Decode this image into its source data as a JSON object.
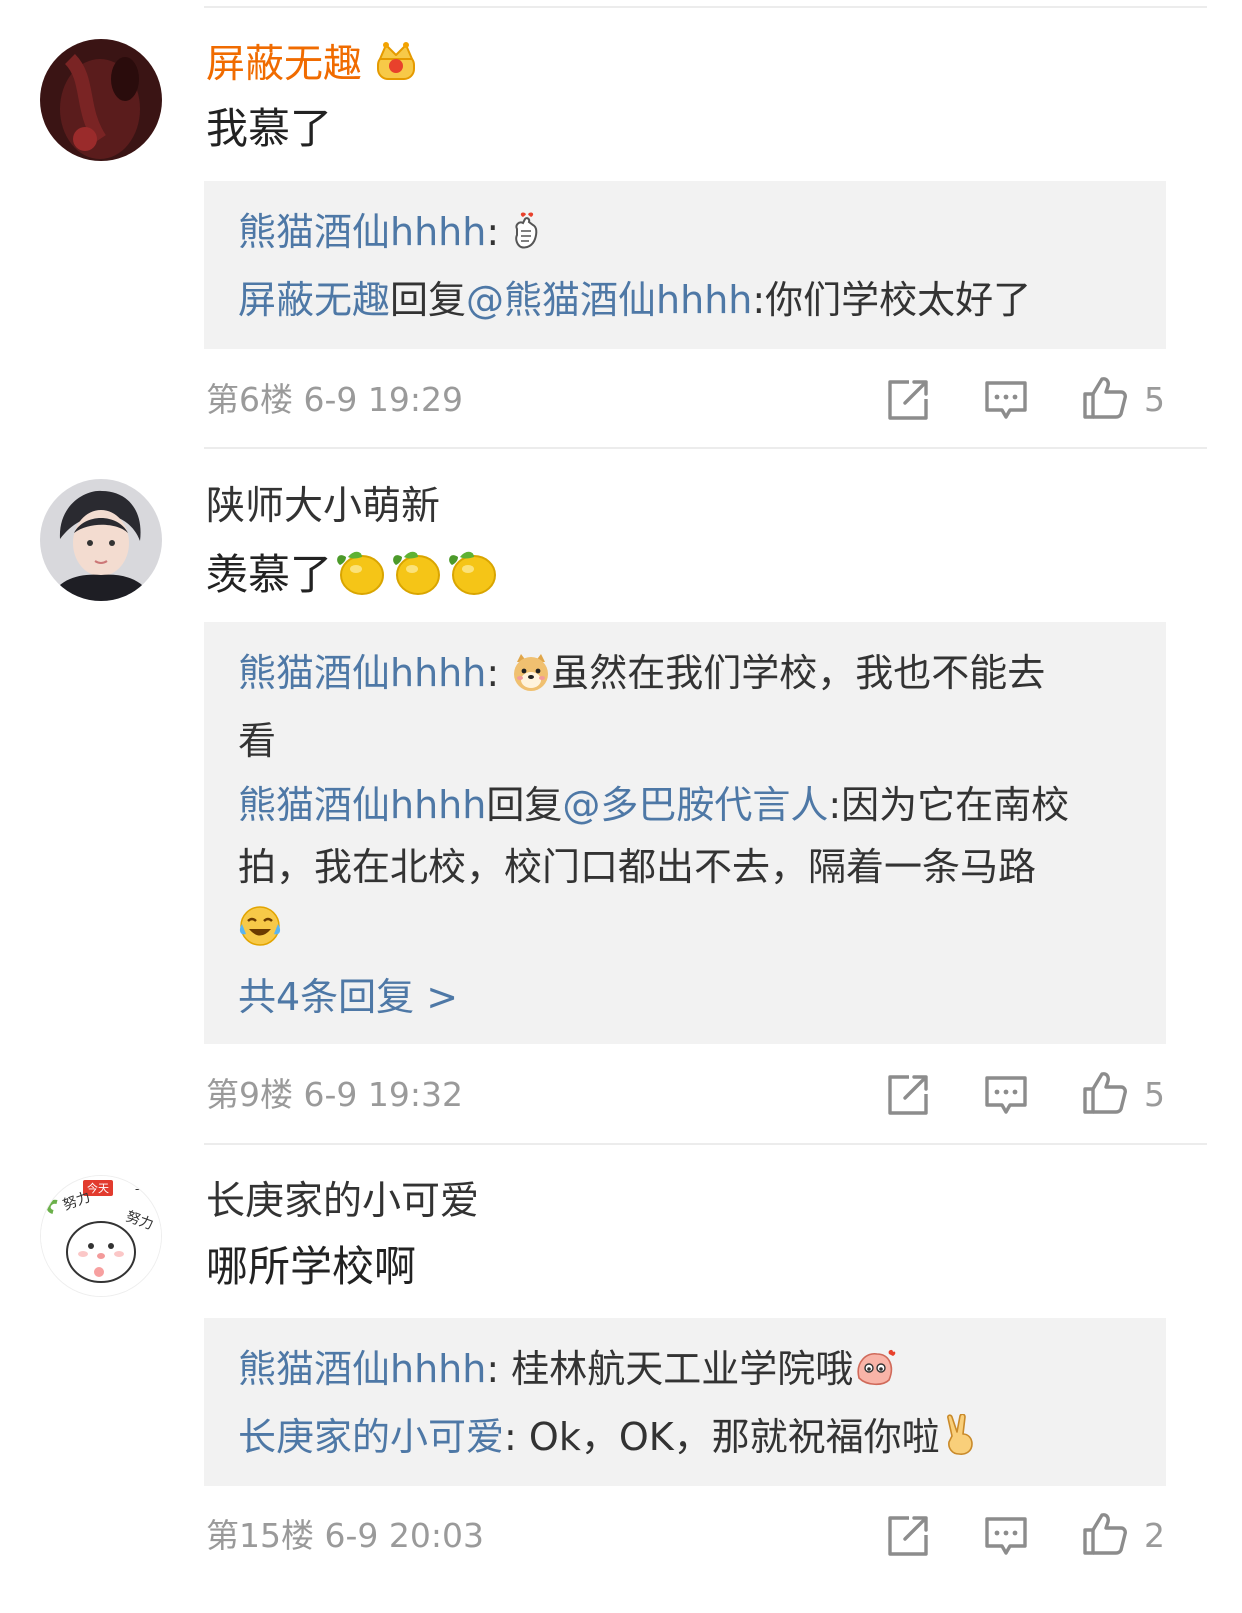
{
  "colors": {
    "vip_name": "#f06b00",
    "link_blue": "#4e78a6",
    "meta_gray": "#9a9a9a",
    "reply_bg": "#f2f2f2"
  },
  "comments": [
    {
      "user": "屏蔽无趣",
      "badge": "crown-icon",
      "text": "我慕了",
      "replies": [
        {
          "user": "熊猫酒仙hhhh",
          "sep": ": ",
          "text": ""
        },
        {
          "user": "屏蔽无趣",
          "reply_word": "回复",
          "mention": "@熊猫酒仙hhhh",
          "text": ":你们学校太好了"
        }
      ],
      "floor": "第6楼",
      "time": "6-9 19:29",
      "likes": "5"
    },
    {
      "user": "陕师大小萌新",
      "text": "羡慕了",
      "replies": [
        {
          "user": "熊猫酒仙hhhh",
          "sep": ": ",
          "text_line1": "虽然在我们学校，我也不能去",
          "text_line2": "看"
        },
        {
          "user": "熊猫酒仙hhhh",
          "reply_word": "回复",
          "mention": "@多巴胺代言人",
          "text_line1": ":因为它在南校",
          "text_line2": "拍，我在北校，校门口都出不去，隔着一条马路"
        }
      ],
      "more": "共4条回复 >",
      "floor": "第9楼",
      "time": "6-9 19:32",
      "likes": "5"
    },
    {
      "user": "长庚家的小可爱",
      "text": "哪所学校啊",
      "replies": [
        {
          "user": "熊猫酒仙hhhh",
          "sep": ": ",
          "text": "桂林航天工业学院哦"
        },
        {
          "user": "长庚家的小可爱",
          "sep": ": ",
          "text": "Ok，OK，那就祝福你啦"
        }
      ],
      "floor": "第15楼",
      "time": "6-9 20:03",
      "likes": "2"
    }
  ],
  "avatar3_text": {
    "tag": "今天",
    "words": "一定努力好"
  }
}
